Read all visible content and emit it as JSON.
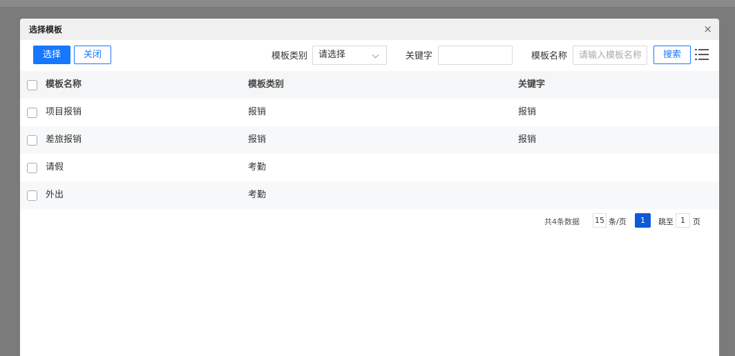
{
  "modal": {
    "title": "选择模板",
    "close_icon": "close-icon"
  },
  "toolbar": {
    "select_label": "选择",
    "close_label": "关闭",
    "category_label": "模板类别",
    "category_value": "请选择",
    "keyword_label": "关键字",
    "keyword_value": "",
    "name_label": "模板名称",
    "name_placeholder": "请输入模板名称",
    "search_label": "搜索",
    "columns_icon": "list-menu-icon"
  },
  "table": {
    "headers": [
      "模板名称",
      "模板类别",
      "关键字"
    ],
    "rows": [
      {
        "name": "项目报销",
        "category": "报销",
        "keyword": "报销"
      },
      {
        "name": "差旅报销",
        "category": "报销",
        "keyword": "报销"
      },
      {
        "name": "请假",
        "category": "考勤",
        "keyword": ""
      },
      {
        "name": "外出",
        "category": "考勤",
        "keyword": ""
      }
    ]
  },
  "pager": {
    "total_text": "共4条数据",
    "page_size": "15",
    "page_size_unit": "条/页",
    "current_page": "1",
    "jump_label": "跳至",
    "jump_value": "1",
    "jump_unit": "页"
  },
  "colors": {
    "primary": "#1677ff",
    "active_page": "#0e59d8",
    "overlay": "#7b7b7b"
  }
}
